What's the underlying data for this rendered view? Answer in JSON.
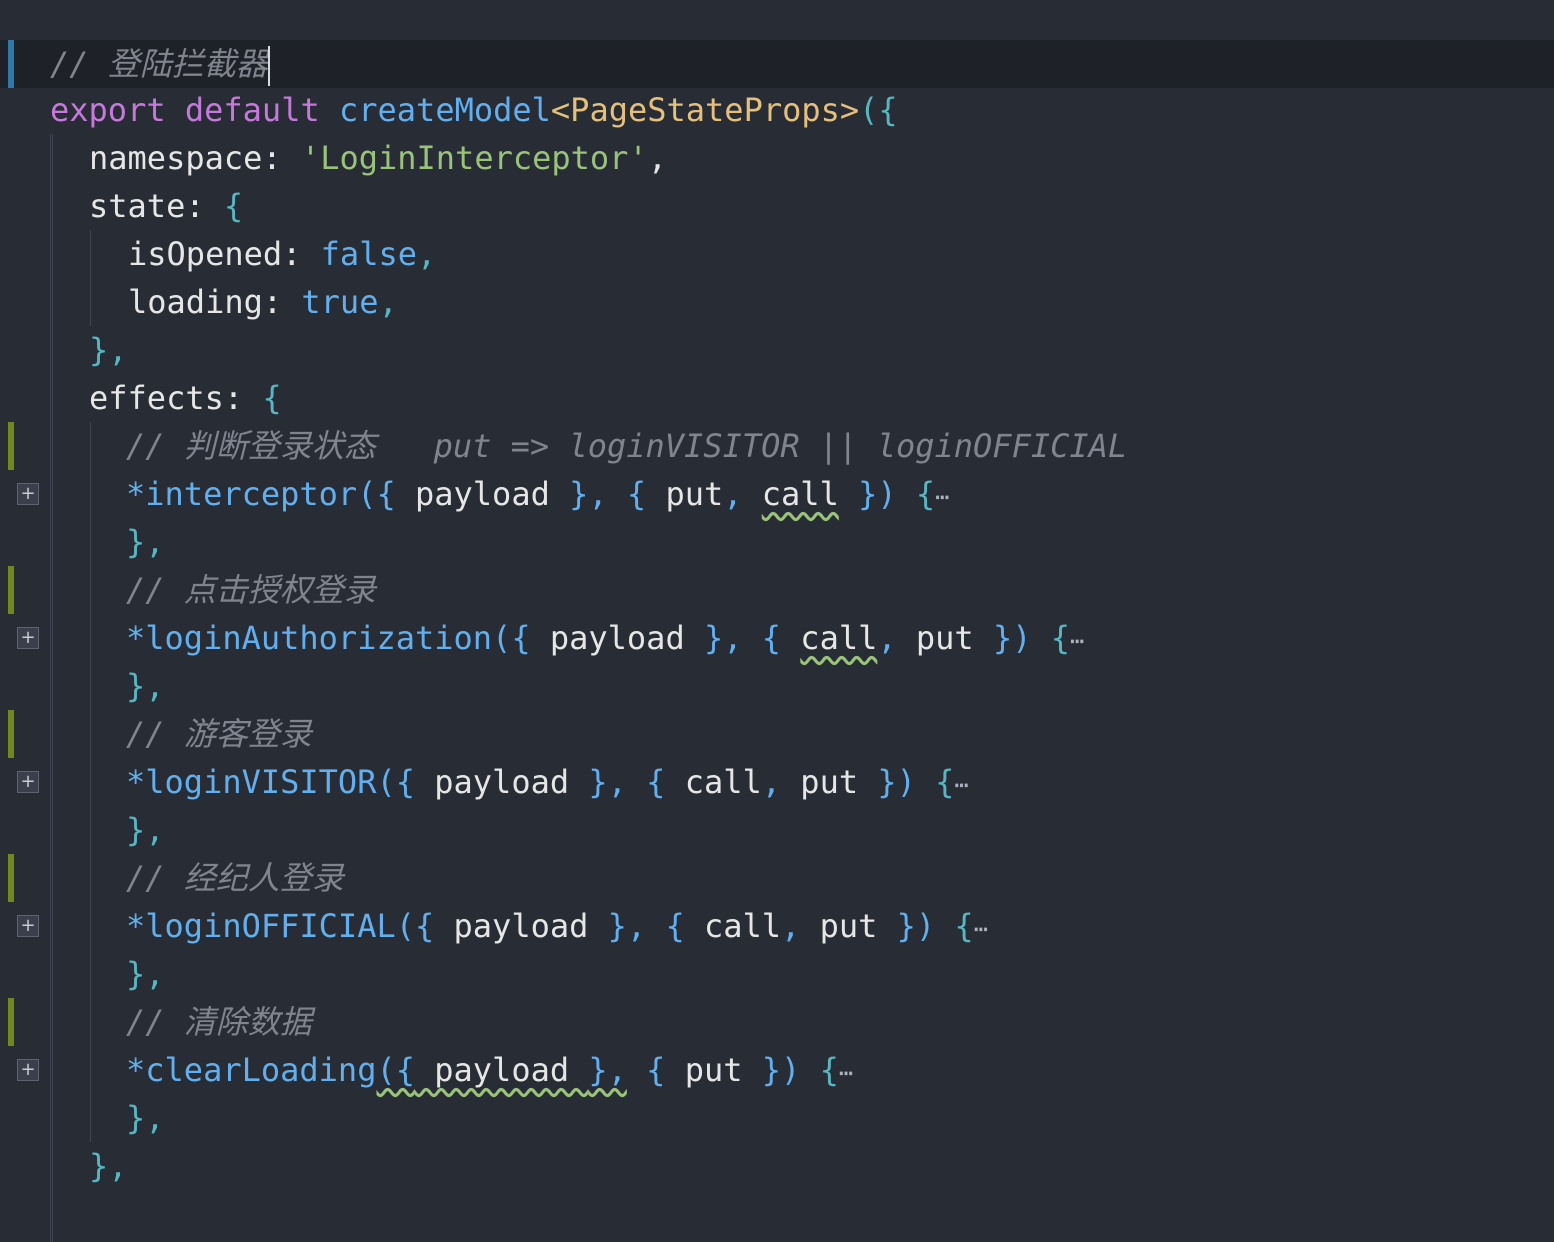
{
  "editor": {
    "language": "typescript",
    "theme_colors": {
      "background": "#282c34",
      "active_line": "#1e2127",
      "keyword": "#c678dd",
      "function": "#61afef",
      "type": "#e5c07b",
      "string": "#98c379",
      "boolean": "#56b6c2",
      "comment": "#7f848e",
      "modified_marker": "#2b79a8",
      "added_marker": "#6f8a1a"
    },
    "lines": [
      {
        "comment": "// 登陆拦截器"
      },
      {
        "kw1": "export",
        "kw2": "default",
        "fn": "createModel",
        "lt": "<",
        "type": "PageStateProps",
        "gt": ">",
        "open": "({"
      },
      {
        "key": "namespace:",
        "value": "'LoginInterceptor'",
        "end": ","
      },
      {
        "key": "state:",
        "open": "{"
      },
      {
        "key": "isOpened:",
        "value": "false",
        "end": ","
      },
      {
        "key": "loading:",
        "value": "true",
        "end": ","
      },
      {
        "text": "},"
      },
      {
        "key": "effects:",
        "open": "{"
      },
      {
        "comment": "// 判断登录状态   put => loginVISITOR || loginOFFICIAL"
      },
      {
        "name": "*interceptor",
        "p1": "({",
        "a1": " payload ",
        "p2": "},",
        "p3": " { ",
        "a2": "put",
        "p4": ", ",
        "a3": "call",
        "p5": " })",
        "p6": " {",
        "ellipsis": "⋯"
      },
      {
        "text": "},"
      },
      {
        "comment": "// 点击授权登录"
      },
      {
        "name": "*loginAuthorization",
        "p1": "({",
        "a1": " payload ",
        "p2": "},",
        "p3": " { ",
        "a2": "call",
        "p4": ", ",
        "a3": "put",
        "p5": " })",
        "p6": " {",
        "ellipsis": "⋯"
      },
      {
        "text": "},"
      },
      {
        "comment": "// 游客登录"
      },
      {
        "name": "*loginVISITOR",
        "p1": "({",
        "a1": " payload ",
        "p2": "},",
        "p3": " { ",
        "a2": "call",
        "p4": ", ",
        "a3": "put",
        "p5": " })",
        "p6": " {",
        "ellipsis": "⋯"
      },
      {
        "text": "},"
      },
      {
        "comment": "// 经纪人登录"
      },
      {
        "name": "*loginOFFICIAL",
        "p1": "({",
        "a1": " payload ",
        "p2": "},",
        "p3": " { ",
        "a2": "call",
        "p4": ", ",
        "a3": "put",
        "p5": " })",
        "p6": " {",
        "ellipsis": "⋯"
      },
      {
        "text": "},"
      },
      {
        "comment": "// 清除数据"
      },
      {
        "name": "*clearLoading",
        "p1": "({",
        "a1": " payload ",
        "p2": "},",
        "p3": " { ",
        "a2": "put",
        "p5": " })",
        "p6": " {",
        "ellipsis": "⋯"
      },
      {
        "text": "},"
      },
      {
        "text": "},"
      }
    ],
    "fold_button_label": "+"
  }
}
